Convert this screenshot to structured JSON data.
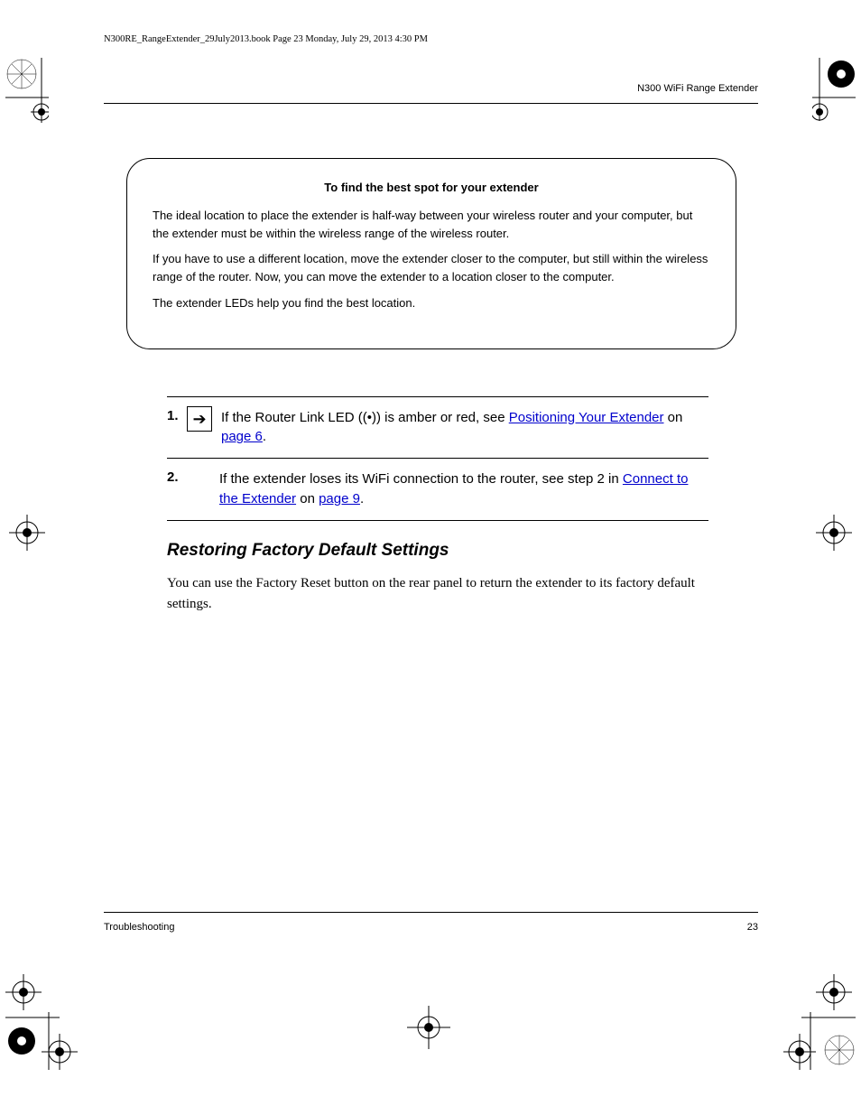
{
  "fm_line": "N300RE_RangeExtender_29July2013.book  Page 23  Monday, July 29, 2013  4:30 PM",
  "running_head": "N300 WiFi Range Extender",
  "box": {
    "title": "To find the best spot for your extender",
    "paragraphs": [
      "The ideal location to place the extender is half-way between your wireless router and your computer, but the extender must be within the wireless range of the wireless router.",
      "If you have to use a different location, move the extender closer to the computer, but still within the wireless range of the router. Now, you can move the extender to a location closer to the computer.",
      "The extender LEDs help you find the best location."
    ]
  },
  "steps": [
    {
      "num": "1.",
      "has_icon": true,
      "main_pre": "If the Router Link LED ",
      "main_link": "((•))",
      "main_post": " is amber or red, see ",
      "link_text": "Positioning Your Extender",
      "link_post": " on ",
      "link_page": "page 6",
      "link_tail": ".",
      "sub": ""
    },
    {
      "num": "2.",
      "has_icon": false,
      "main_pre": "If the extender loses its WiFi connection to the router, see step 2 in ",
      "link_text": "Connect to the Extender",
      "link_post": " on ",
      "link_page": "page 9",
      "link_tail": ".",
      "sub": ""
    }
  ],
  "heading": "Restoring Factory Default Settings",
  "body_para": "You can use the Factory Reset button on the rear panel to return the extender to its factory default settings.",
  "footer": {
    "left": "Troubleshooting",
    "right": "23"
  }
}
